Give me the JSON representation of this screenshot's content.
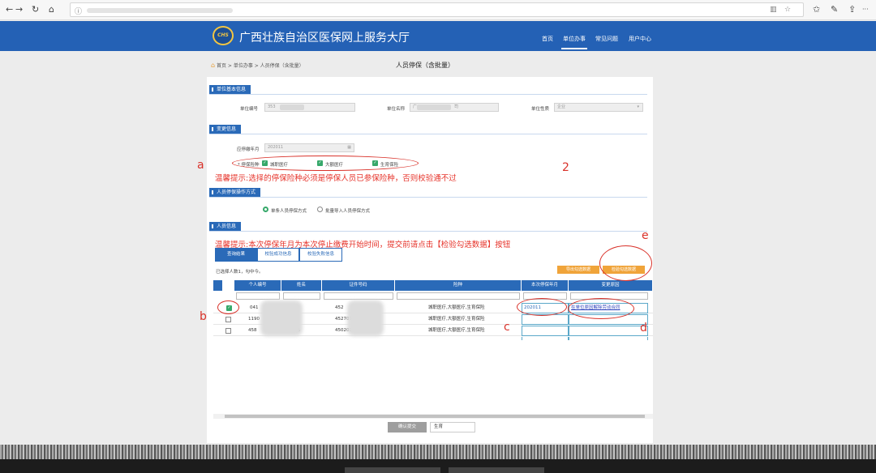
{
  "browser": {
    "back_icon": "←",
    "forward_icon": "→",
    "refresh_icon": "↻",
    "home_icon": "⌂",
    "info_icon": "ⓘ",
    "reader_icon": "▥",
    "star_icon": "☆",
    "favorites_icon": "✩",
    "pen_icon": "✎",
    "share_icon": "⇪",
    "more_icon": "···"
  },
  "header": {
    "logo_text": "CHS",
    "site_title": "广西壮族自治区医保网上服务大厅",
    "nav": [
      "首页",
      "单位办事",
      "常见问题",
      "用户中心"
    ],
    "active_nav": "单位办事",
    "brand_color": "#2461b5"
  },
  "breadcrumb": "首页 > 单位办事 > 人员停保（含批量）",
  "page_title": "人员停保（含批量）",
  "sections": {
    "unit_basic": "单位基本信息",
    "change_info": "变更信息",
    "operation_mode": "人员停保操作方式",
    "person_info": "人员信息"
  },
  "unit": {
    "unit_no_label": "单位编号",
    "unit_no_value": "353",
    "unit_name_label": "单位名称",
    "unit_name_value": "广",
    "unit_name_suffix": "司",
    "unit_type_label": "单位性质",
    "unit_type_value": "企业"
  },
  "change": {
    "stop_month_label": "应停缴年月",
    "stop_month_value": "202011",
    "insurance_label": "停保险种",
    "insurance_options": [
      "城职医疗",
      "大额医疗",
      "生育保险"
    ]
  },
  "warnings": {
    "warning1": "温馨提示:选择的停保险种必须是停保人员已参保险种，否则校验通不过",
    "warning2": "温馨提示:本次停保年月为本次停止缴费开始时间，提交前请点击【检验勾选数据】按钮"
  },
  "operation_modes": [
    "单条人员停保方式",
    "批量导入人员停保方式"
  ],
  "result_tabs": [
    "查询结果",
    "校验成功信息",
    "校验失败信息"
  ],
  "selected_count": "已选择人数1，勾中今。",
  "buttons": {
    "export": "导出勾选数据",
    "validate": "检验勾选数据",
    "submit": "确认提交",
    "note": "生育"
  },
  "table": {
    "headers": [
      "个人编号",
      "姓名",
      "证件号码",
      "险种",
      "本次停保年月",
      "变更原因"
    ],
    "rows": [
      {
        "checked": true,
        "person_no": "041",
        "name": "",
        "id_no": "452",
        "insurance": "城职医疗,大额医疗,生育保险",
        "stop_month": "202011",
        "reason": "在单位原因解除劳动合同"
      },
      {
        "checked": false,
        "person_no": "1190",
        "name": "",
        "id_no": "452701196",
        "insurance": "城职医疗,大额医疗,生育保险",
        "stop_month": "",
        "reason": ""
      },
      {
        "checked": false,
        "person_no": "458",
        "name": "$",
        "id_no": "450203196",
        "insurance": "城职医疗,大额医疗,生育保险",
        "stop_month": "",
        "reason": ""
      }
    ]
  },
  "annotations": [
    "a",
    "2",
    "b",
    "c",
    "d",
    "e"
  ],
  "annotation_color": "#d9322a"
}
